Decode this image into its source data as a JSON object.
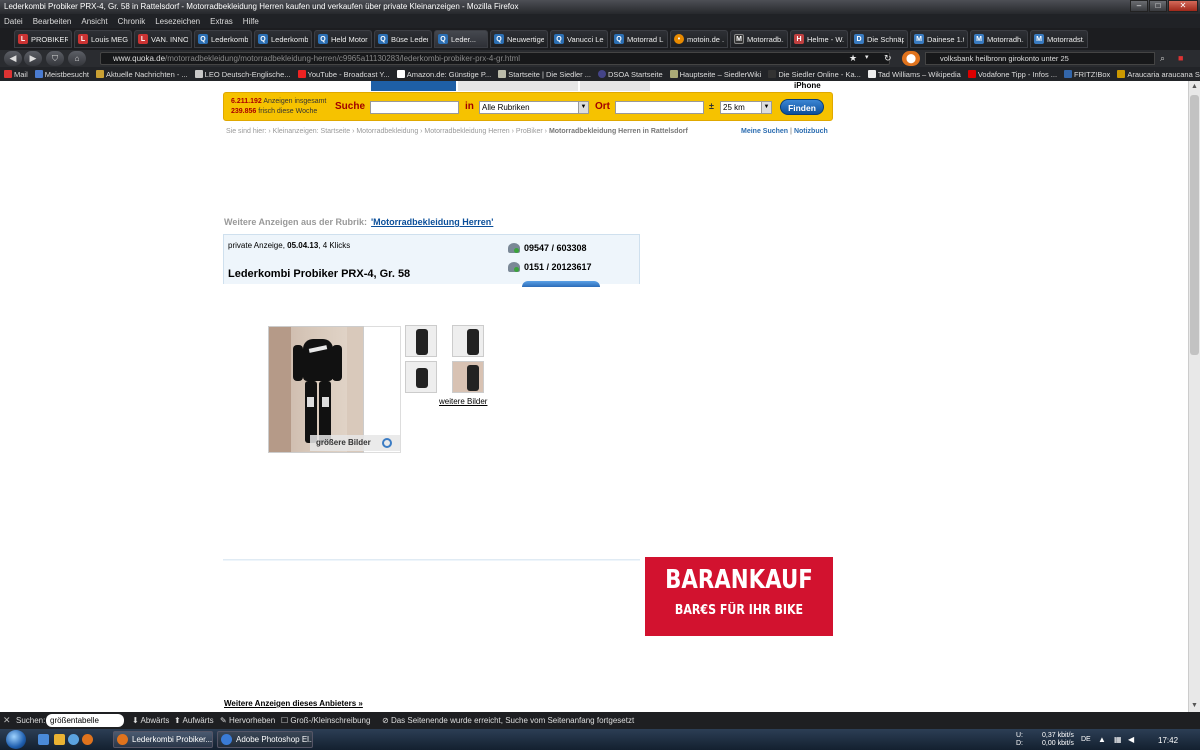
{
  "window": {
    "title": "Lederkombi Probiker PRX-4, Gr. 58 in Rattelsdorf - Motorradbekleidung Herren kaufen und verkaufen über private Kleinanzeigen - Mozilla Firefox",
    "minimize": "–",
    "maximize": "□",
    "close": "✕"
  },
  "menu": [
    "Datei",
    "Bearbeiten",
    "Ansicht",
    "Chronik",
    "Lesezeichen",
    "Extras",
    "Hilfe"
  ],
  "tabs": [
    {
      "label": "PROBIKER ...",
      "icon": "L"
    },
    {
      "label": "Louis MEG...",
      "icon": "L"
    },
    {
      "label": "VAN. INNO...",
      "icon": "L"
    },
    {
      "label": "Lederkomb...",
      "icon": "Q"
    },
    {
      "label": "Lederkomb...",
      "icon": "Q"
    },
    {
      "label": "Held Motor...",
      "icon": "Q"
    },
    {
      "label": "Büse Leder...",
      "icon": "Q"
    },
    {
      "label": "Leder...",
      "icon": "Q",
      "active": true
    },
    {
      "label": "Neuwertige...",
      "icon": "Q"
    },
    {
      "label": "Vanucci Le...",
      "icon": "Q"
    },
    {
      "label": "Motorrad L...",
      "icon": "Q"
    },
    {
      "label": "motoin.de ...",
      "icon": "•"
    },
    {
      "label": "Motorradb...",
      "icon": "M"
    },
    {
      "label": "Helme - W...",
      "icon": "H"
    },
    {
      "label": "Die Schnäp...",
      "icon": "D"
    },
    {
      "label": "Dainese 1.tl...",
      "icon": "M"
    },
    {
      "label": "Motorradh...",
      "icon": "M"
    },
    {
      "label": "Motorradst...",
      "icon": "M"
    }
  ],
  "nav": {
    "url_host": "www.quoka.de",
    "url_path": "/motorradbekleidung/motorradbekleidung-herren/c9965a11130283/lederkombi-probiker-prx-4-gr.html",
    "search_value": "volksbank heilbronn girokonto unter 25",
    "back": "◀",
    "forward": "▶",
    "star": "★",
    "reload": "↻"
  },
  "bookmarks": [
    "Mail",
    "Meistbesucht",
    "Aktuelle Nachrichten - ...",
    "LEO Deutsch-Englische...",
    "YouTube - Broadcast Y...",
    "Amazon.de: Günstige P...",
    "Startseite | Die Siedler ...",
    "DSOA Startseite",
    "Hauptseite – SiedlerWiki",
    "Die Siedler Online - Ka...",
    "Tad Williams – Wikipedia",
    "Vodafone Tipp - Infos ...",
    "FRITZ!Box",
    "Araucaria araucana Sch..."
  ],
  "page": {
    "iphone": "iPhone",
    "search": {
      "count_total": "6.211.192",
      "count_total_suffix": " Anzeigen insgesamt",
      "count_new": "239.856",
      "count_new_suffix": " frisch diese Woche",
      "suche_label": "Suche",
      "in_label": "in",
      "category": "Alle Rubriken",
      "ort_label": "Ort",
      "radius_sign": "±",
      "radius": "25 km",
      "find_button": "Finden"
    },
    "breadcrumb_prefix": "Sie sind hier: › Kleinanzeigen: Startseite › Motorradbekleidung › Motorradbekleidung Herren › ProBiker › ",
    "breadcrumb_current": "Motorradbekleidung Herren in Rattelsdorf",
    "meine_suchen": "Meine Suchen",
    "separator": "|",
    "notizbuch": "Notizbuch",
    "rubrik_label": "Weitere Anzeigen aus der Rubrik:",
    "rubrik_link": "'Motorradbekleidung Herren'",
    "ad": {
      "meta_prefix": "private Anzeige, ",
      "date": "05.04.13",
      "meta_suffix": ", 4 Klicks",
      "title": "Lederkombi Probiker PRX-4, Gr. 58",
      "phone1": "09547 / 603308",
      "phone2": "0151 / 20123617"
    },
    "bigger_pics": "größere Bilder",
    "more_pics": "weitere Bilder",
    "banner_line1": "BARANKAUF",
    "banner_line2": "BAR€S FÜR IHR BIKE",
    "more_ads": "Weitere Anzeigen dieses Anbieters »"
  },
  "findbar": {
    "close": "✕",
    "label": "Suchen:",
    "value": "größentabelle",
    "down": "Abwärts",
    "up": "Aufwärts",
    "highlight": "Hervorheben",
    "case": "Groß-/Kleinschreibung",
    "status": "Das Seitenende wurde erreicht, Suche vom Seitenanfang fortgesetzt"
  },
  "taskbar": {
    "task1": "Lederkombi Probiker...",
    "task2": "Adobe Photoshop El...",
    "up_label": "U:",
    "up_rate": "0,37 kbit/s",
    "down_label": "D:",
    "down_rate": "0,00 kbit/s",
    "lang": "DE",
    "time": "17:42"
  }
}
